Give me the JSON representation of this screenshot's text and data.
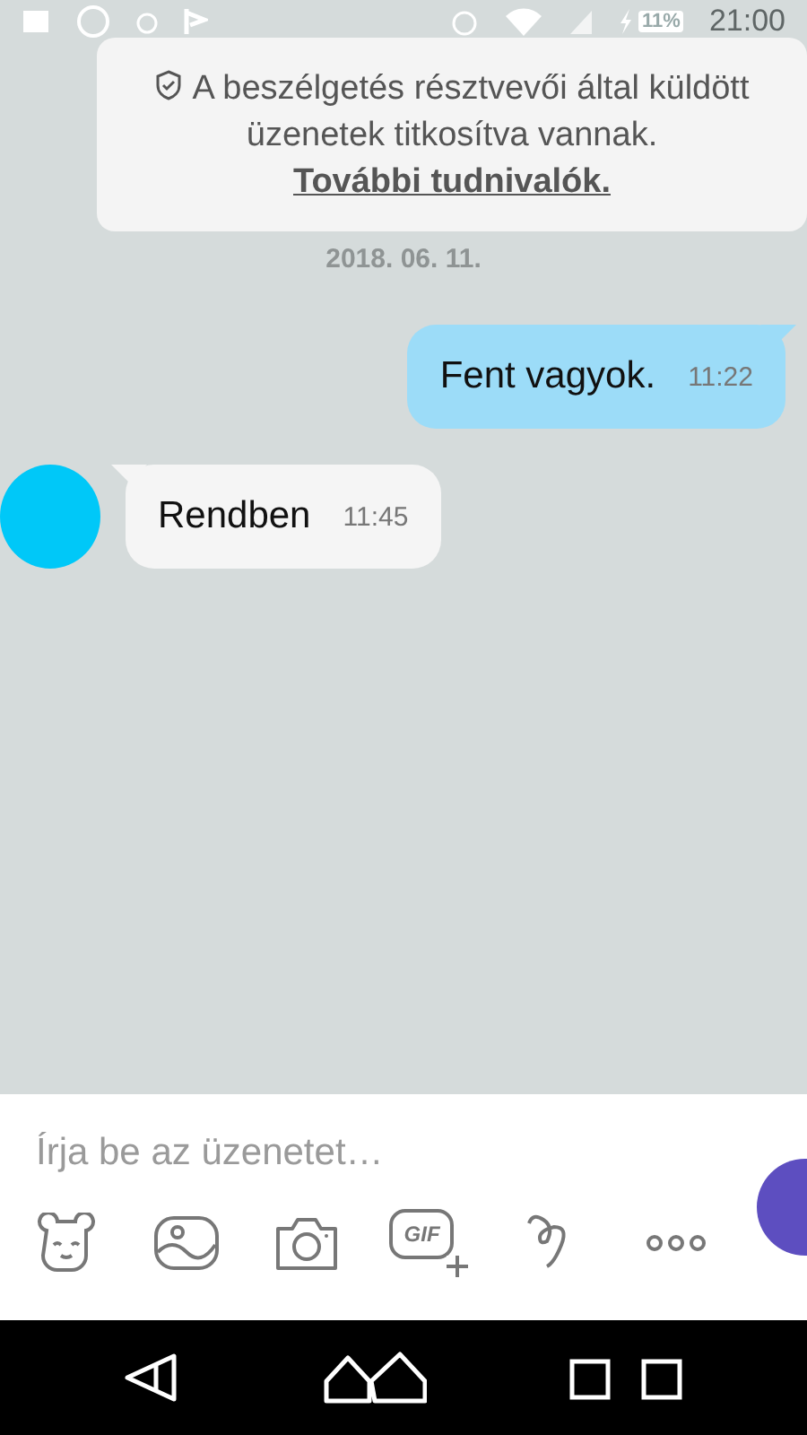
{
  "status_bar": {
    "battery": "11%",
    "time": "21:00"
  },
  "encryption_notice": {
    "text": "A beszélgetés résztvevői által küldött üzenetek titkosítva vannak.",
    "link": "További tudnivalók."
  },
  "date_separator": "2018. 06. 11.",
  "messages": [
    {
      "kind": "outgoing",
      "text": "Fent vagyok.",
      "time": "11:22"
    },
    {
      "kind": "incoming",
      "text": "Rendben",
      "time": "11:45"
    }
  ],
  "composer": {
    "placeholder": "Írja be az üzenetet…",
    "gif_label": "GIF"
  }
}
